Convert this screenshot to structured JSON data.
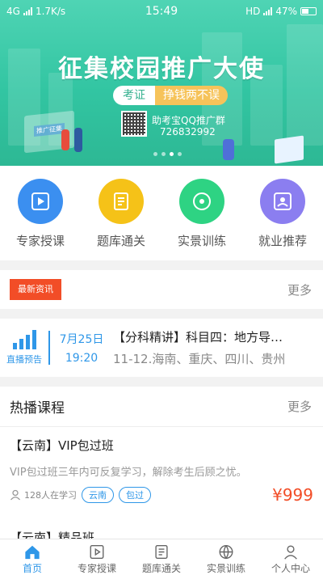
{
  "status_bar": {
    "network": "4G",
    "speed": "1.7K/s",
    "time": "15:49",
    "hd": "HD",
    "battery": "47%"
  },
  "banner": {
    "title": "征集校园推广大使",
    "tag_left": "考证",
    "tag_right": "挣钱两不误",
    "qq_label": "助考宝QQ推广群",
    "qq_number": "726832992",
    "board_label": "推广征集",
    "page_count": 4,
    "active_page": 3
  },
  "quick_entries": [
    {
      "label": "专家授课",
      "icon": "play-icon",
      "color": "#3b8ff0"
    },
    {
      "label": "题库通关",
      "icon": "document-icon",
      "color": "#f5c218"
    },
    {
      "label": "实景训练",
      "icon": "disc-icon",
      "color": "#2ed383"
    },
    {
      "label": "就业推荐",
      "icon": "person-card-icon",
      "color": "#8b7ef0"
    }
  ],
  "news": {
    "badge": "最新资讯",
    "more": "更多"
  },
  "live": {
    "label": "直播预告",
    "date": "7月25日",
    "time": "19:20",
    "title": "【分科精讲】科目四：地方导…",
    "subtitle": "11-12.海南、重庆、四川、贵州"
  },
  "hot_courses": {
    "heading": "热播课程",
    "more": "更多",
    "course1": {
      "title": "【云南】VIP包过班",
      "desc": "VIP包过班三年内可反复学习，解除考生后顾之忧。",
      "learners": "128人在学习",
      "tag1": "云南",
      "tag2": "包过",
      "price": "¥999"
    },
    "course2_title": "【云南】精品班"
  },
  "tabbar": [
    {
      "label": "首页",
      "icon": "home-icon",
      "active": true
    },
    {
      "label": "专家授课",
      "icon": "play-icon",
      "active": false
    },
    {
      "label": "题库通关",
      "icon": "document-icon",
      "active": false
    },
    {
      "label": "实景训练",
      "icon": "globe-icon",
      "active": false
    },
    {
      "label": "个人中心",
      "icon": "user-icon",
      "active": false
    }
  ],
  "colors": {
    "accent": "#2f97e8",
    "banner": "#32c5a2",
    "price": "#f24d27"
  }
}
